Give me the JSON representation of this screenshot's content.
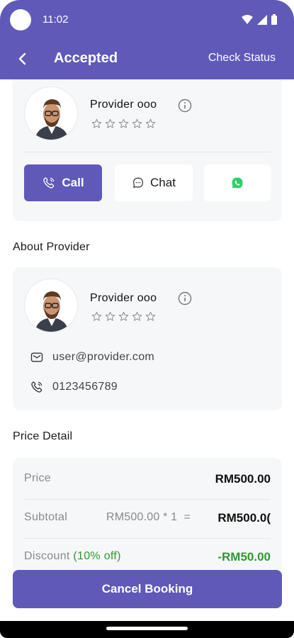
{
  "status_bar": {
    "time": "11:02"
  },
  "app_bar": {
    "title": "Accepted",
    "action": "Check Status"
  },
  "provider_card": {
    "name": "Provider ooo",
    "rating": 0,
    "buttons": {
      "call": "Call",
      "chat": "Chat"
    }
  },
  "about": {
    "section_title": "About Provider",
    "name": "Provider ooo",
    "rating": 0,
    "email": "user@provider.com",
    "phone": "0123456789"
  },
  "price_detail": {
    "section_title": "Price Detail",
    "rows": [
      {
        "label": "Price",
        "value": "RM500.00"
      },
      {
        "label": "Subtotal",
        "formula": "RM500.00 * 1  =",
        "value": "RM500.0("
      },
      {
        "label": "Discount",
        "label_note": "(10% off)",
        "value": "-RM50.00"
      }
    ]
  },
  "cancel_label": "Cancel Booking",
  "colors": {
    "primary": "#5F5AB8",
    "discount": "#2E9A2E",
    "card_bg": "#F6F7F9",
    "whatsapp": "#25D366"
  }
}
